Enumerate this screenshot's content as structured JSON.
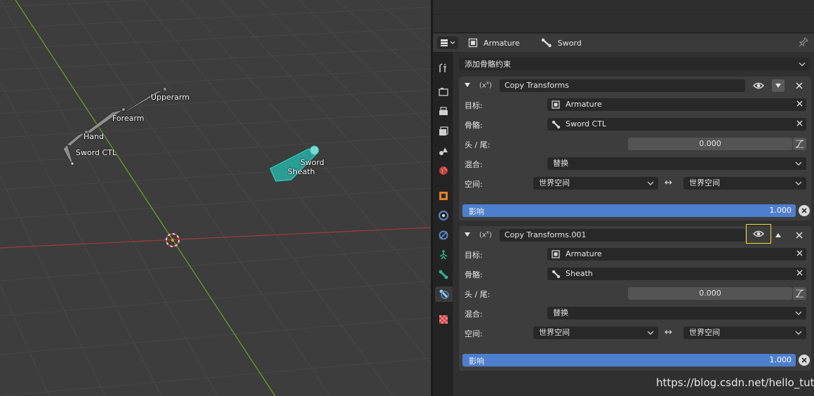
{
  "viewport": {
    "bone_labels": [
      "Upperarm",
      "Forearm",
      "Hand",
      "Sword CTL",
      "Sword",
      "Sheath"
    ],
    "x_axis_color": "#9a3b3b",
    "y_axis_color": "#6c9a2b",
    "selected_color": "#2ed1c4"
  },
  "properties": {
    "breadcrumb": {
      "object": "Armature",
      "bone": "Sword"
    },
    "add_constraint_label": "添加骨骼约束",
    "tabs": [
      "tool-icon",
      "render-icon",
      "output-icon",
      "view-layer-icon",
      "scene-icon",
      "world-icon",
      "object-icon",
      "modifier-icon",
      "physics-icon",
      "object-data-icon",
      "bone-icon",
      "bone-constraint-icon",
      "texture-icon"
    ],
    "active_tab": "bone-constraint-icon",
    "constraints": [
      {
        "name": "Copy Transforms",
        "target_label": "目标:",
        "target": "Armature",
        "bone_label": "骨骼:",
        "bone": "Sword CTL",
        "head_tail_label": "头 / 尾:",
        "head_tail": "0.000",
        "mix_label": "混合:",
        "mix": "替换",
        "space_label": "空间:",
        "owner_space": "世界空间",
        "target_space": "世界空间",
        "influence_label": "影响",
        "influence": "1.000"
      },
      {
        "name": "Copy Transforms.001",
        "target_label": "目标:",
        "target": "Armature",
        "bone_label": "骨骼:",
        "bone": "Sheath",
        "head_tail_label": "头 / 尾:",
        "head_tail": "0.000",
        "mix_label": "混合:",
        "mix": "替换",
        "space_label": "空间:",
        "owner_space": "世界空间",
        "target_space": "世界空间",
        "influence_label": "影响",
        "influence": "1.000"
      }
    ],
    "influence_color": "#4d7fce",
    "highlight_color": "#f0e040"
  },
  "watermark": "https://blog.csdn.net/hello_tute"
}
